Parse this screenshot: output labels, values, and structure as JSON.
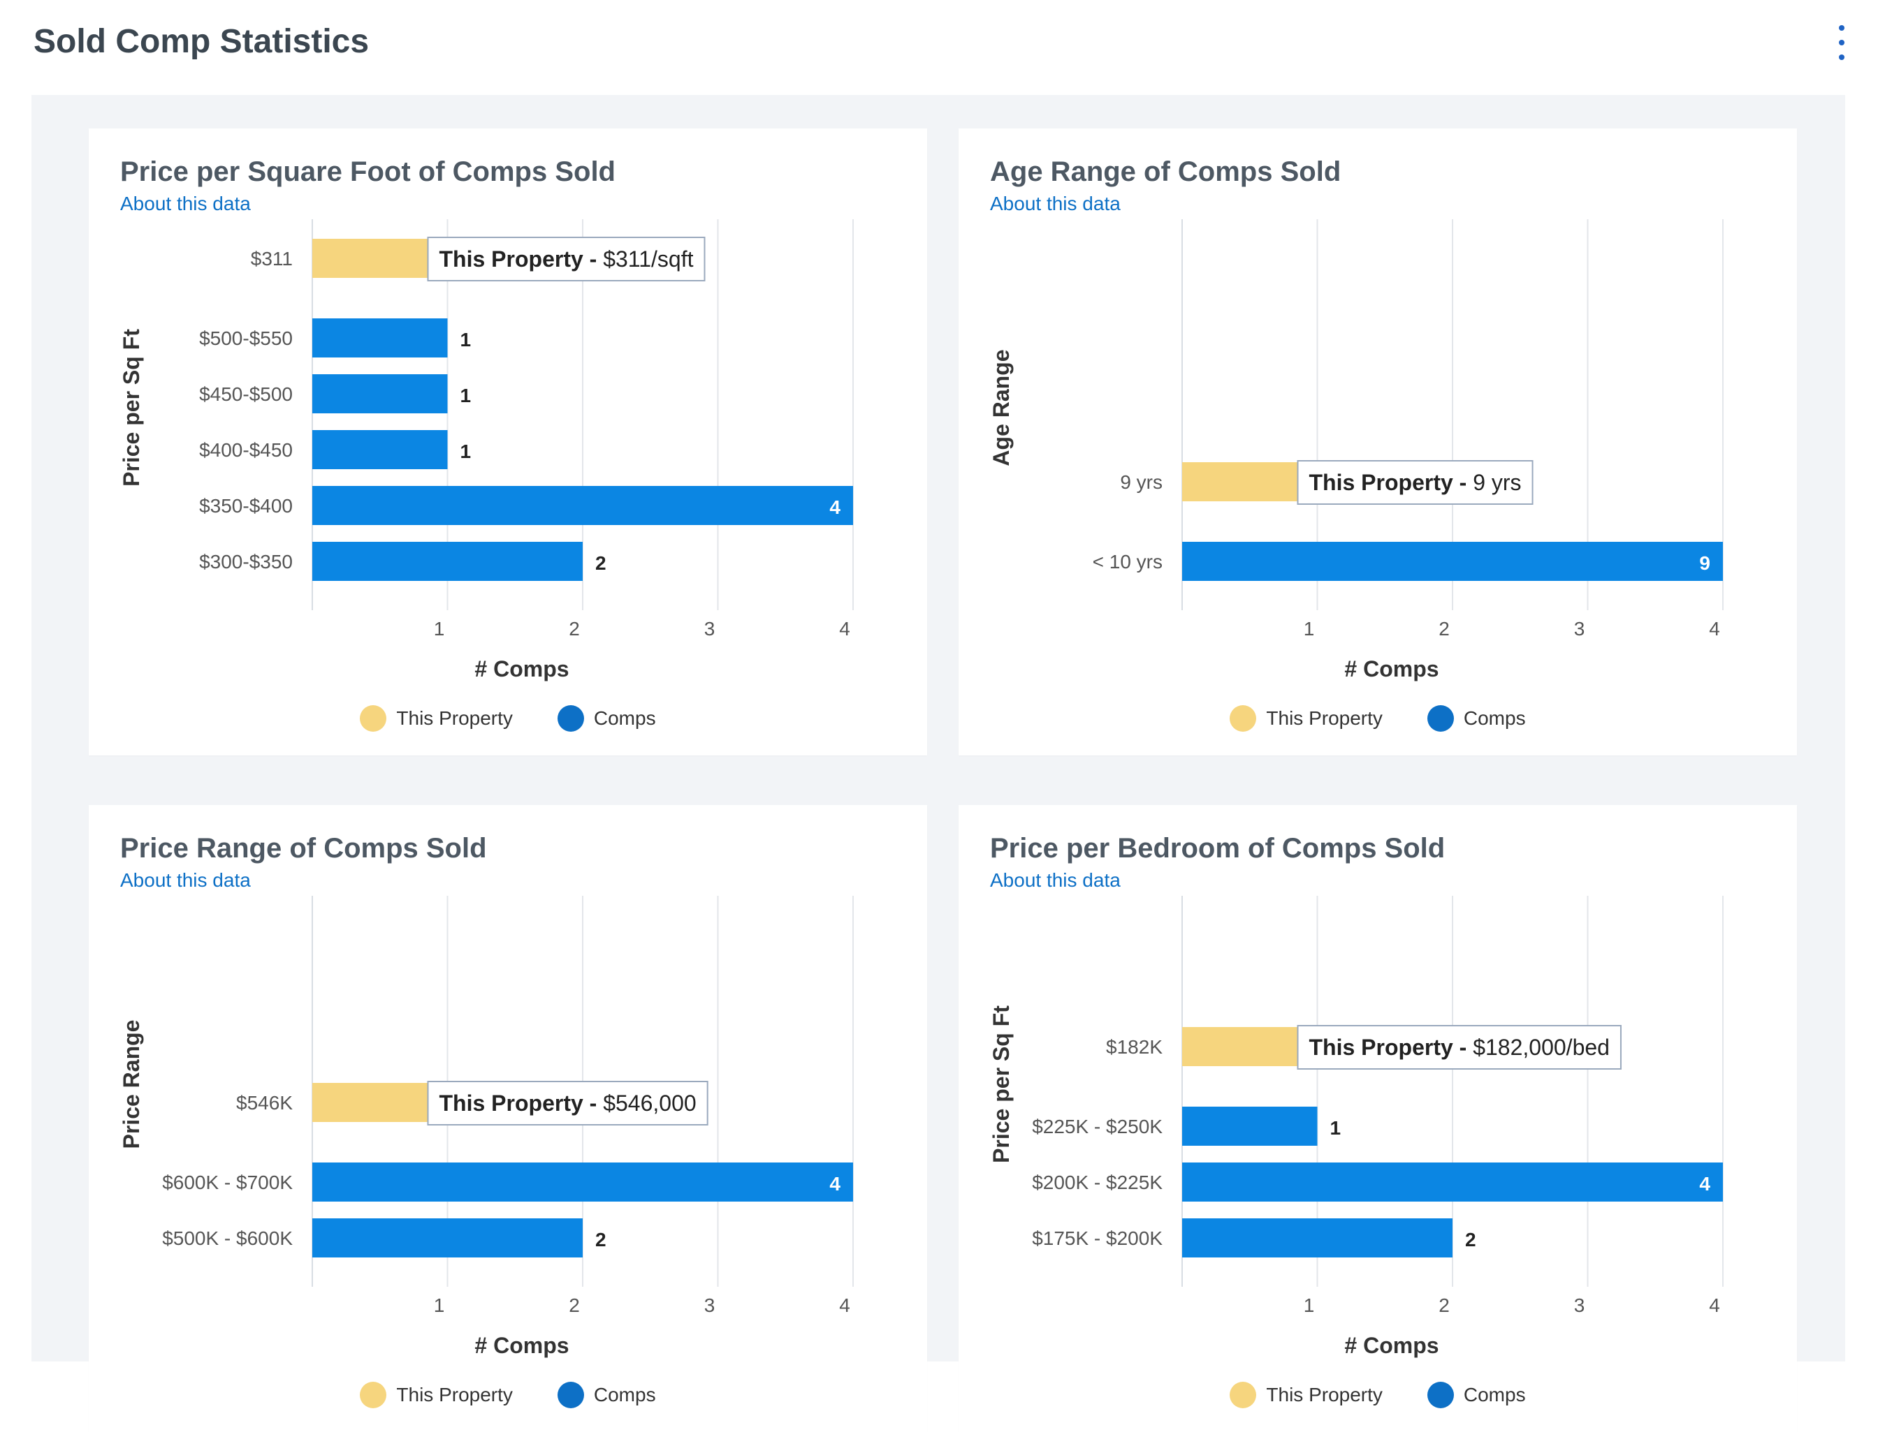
{
  "page": {
    "title": "Sold Comp Statistics"
  },
  "legend": {
    "this_property": "This Property",
    "comps": "Comps"
  },
  "colors": {
    "this_property": "#f6d57e",
    "comps": "#0b86e3",
    "legend_comps": "#0d70c6",
    "link": "#0d70c6"
  },
  "charts": [
    {
      "title": "Price per Square Foot of Comps Sold",
      "about_link": "About this data",
      "chart_data": {
        "type": "bar",
        "orientation": "horizontal",
        "ylabel": "Price per Sq Ft",
        "xlabel": "# Comps",
        "xticks": [
          1,
          2,
          3,
          4
        ],
        "xlim": [
          0,
          4
        ],
        "this_property": {
          "category": "$311",
          "value": 1,
          "tooltip_bold": "This Property - ",
          "tooltip_value": "$311/sqft"
        },
        "categories": [
          "$500-$550",
          "$450-$500",
          "$400-$450",
          "$350-$400",
          "$300-$350"
        ],
        "values": [
          1,
          1,
          1,
          4,
          2
        ],
        "value_labels": [
          "1",
          "1",
          "1",
          "4",
          "2"
        ]
      }
    },
    {
      "title": "Age Range of Comps Sold",
      "about_link": "About this data",
      "chart_data": {
        "type": "bar",
        "orientation": "horizontal",
        "ylabel": "Age Range",
        "xlabel": "# Comps",
        "xticks": [
          1,
          2,
          3,
          4
        ],
        "xlim": [
          0,
          4
        ],
        "this_property": {
          "category": "9 yrs",
          "value": 1,
          "tooltip_bold": "This Property - ",
          "tooltip_value": "9 yrs"
        },
        "categories": [
          "< 10 yrs"
        ],
        "values": [
          4
        ],
        "value_labels": [
          "9"
        ]
      }
    },
    {
      "title": "Price Range of Comps Sold",
      "about_link": "About this data",
      "chart_data": {
        "type": "bar",
        "orientation": "horizontal",
        "ylabel": "Price Range",
        "xlabel": "# Comps",
        "xticks": [
          1,
          2,
          3,
          4
        ],
        "xlim": [
          0,
          4
        ],
        "this_property": {
          "category": "$546K",
          "value": 1,
          "tooltip_bold": "This Property - ",
          "tooltip_value": "$546,000"
        },
        "categories": [
          "$600K - $700K",
          "$500K - $600K"
        ],
        "values": [
          4,
          2
        ],
        "value_labels": [
          "4",
          "2"
        ]
      }
    },
    {
      "title": "Price per Bedroom of Comps Sold",
      "about_link": "About this data",
      "chart_data": {
        "type": "bar",
        "orientation": "horizontal",
        "ylabel": "Price per Sq Ft",
        "xlabel": "# Comps",
        "xticks": [
          1,
          2,
          3,
          4
        ],
        "xlim": [
          0,
          4
        ],
        "this_property": {
          "category": "$182K",
          "value": 1,
          "tooltip_bold": "This Property - ",
          "tooltip_value": "$182,000/bed"
        },
        "categories": [
          "$225K - $250K",
          "$200K - $225K",
          "$175K - $200K"
        ],
        "values": [
          1,
          4,
          2
        ],
        "value_labels": [
          "1",
          "4",
          "2"
        ]
      }
    }
  ]
}
